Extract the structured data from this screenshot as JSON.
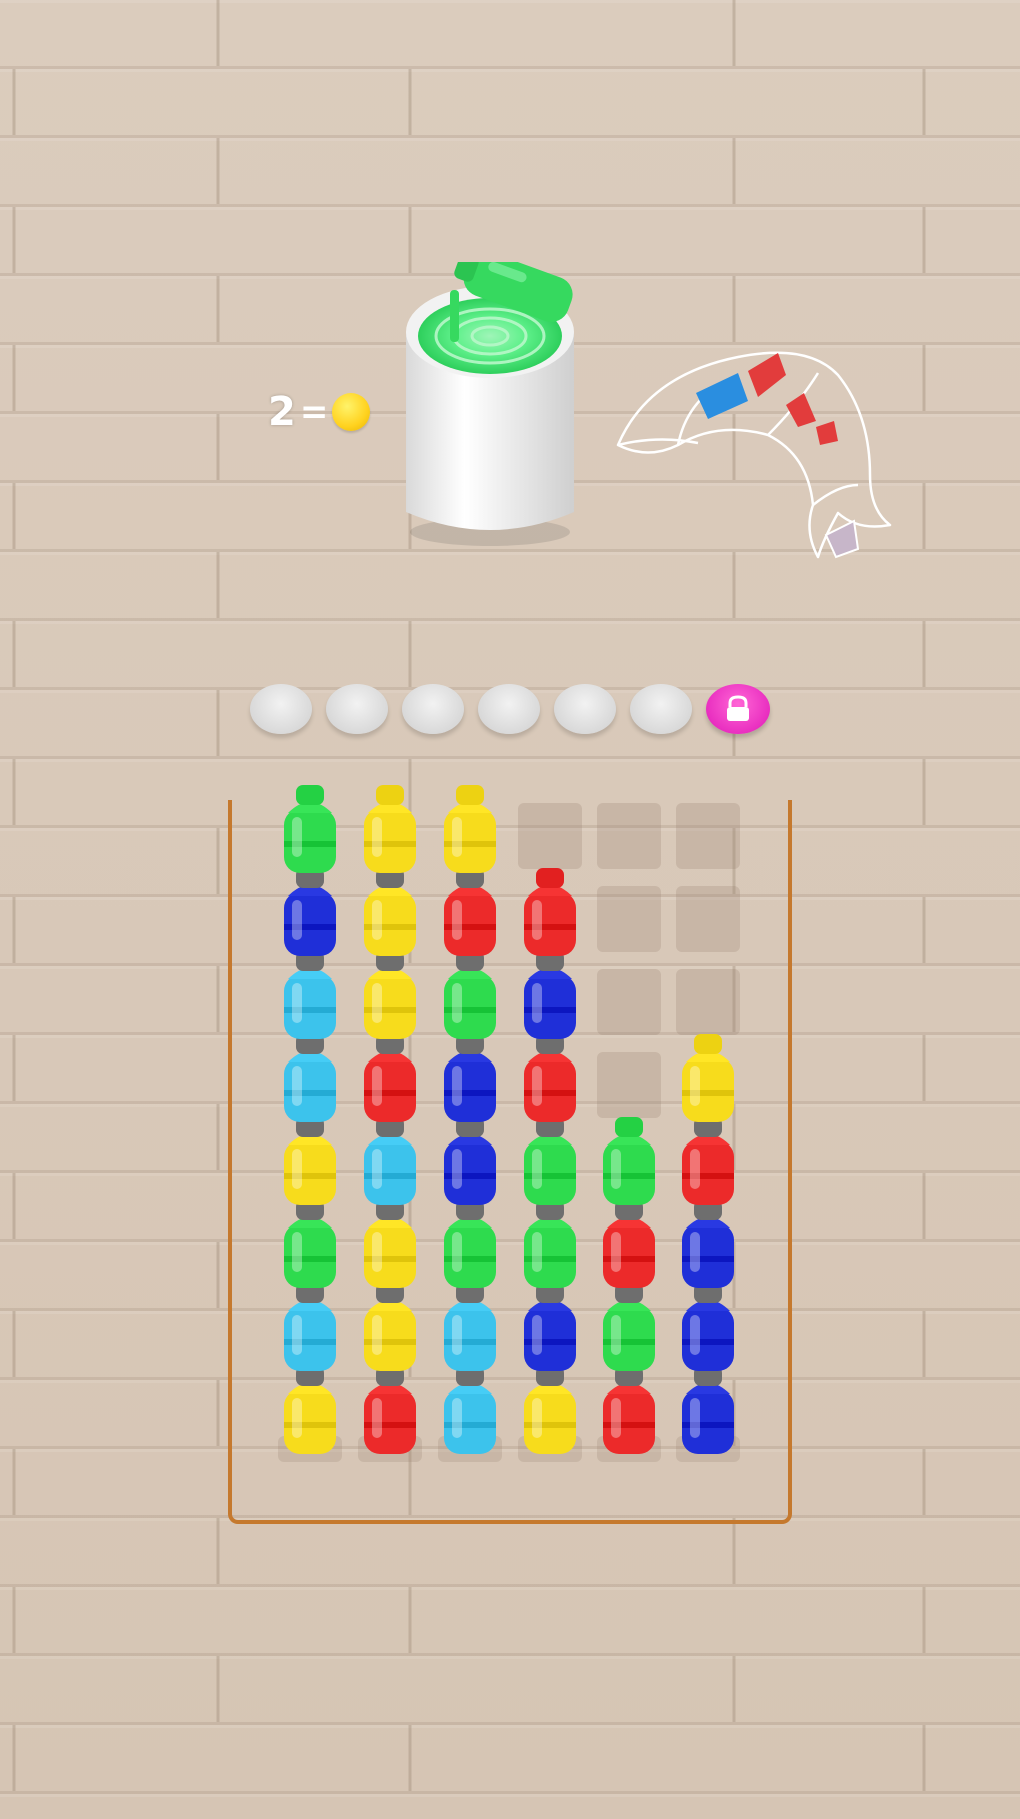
{
  "hud": {
    "counter_value": "2",
    "equals": "=",
    "coin_icon": "coin-icon"
  },
  "cup": {
    "liquid_color": "#3ee86e",
    "pouring_bottle_color": "#36d95f"
  },
  "picture_progress": {
    "shape": "dolphin-outline-icon",
    "painted_colors": [
      "#2a8ee0",
      "#e23c3c"
    ]
  },
  "queue": {
    "empty_slots": 6,
    "locked_slot_icon": "ad-lock-icon",
    "locked_color": "#e92fc0"
  },
  "colors": {
    "green": "#2edb4e",
    "yellow": "#f7dc1c",
    "blue": "#1f2fd8",
    "cyan": "#3cc3ec",
    "red": "#ec2a2a",
    "cap": "#6e6e6e",
    "tray_border": "#c5792e"
  },
  "columns": [
    [
      "green",
      "blue",
      "cyan",
      "cyan",
      "yellow",
      "green",
      "cyan",
      "yellow"
    ],
    [
      "yellow",
      "yellow",
      "yellow",
      "red",
      "cyan",
      "yellow",
      "yellow",
      "red"
    ],
    [
      "yellow",
      "red",
      "green",
      "blue",
      "blue",
      "green",
      "cyan",
      "cyan"
    ],
    [
      "red",
      "blue",
      "red",
      "green",
      "green",
      "blue",
      "yellow"
    ],
    [
      "green",
      "red",
      "green",
      "red"
    ],
    [
      "yellow",
      "red",
      "blue",
      "blue",
      "blue"
    ]
  ],
  "column_capacity": 8
}
